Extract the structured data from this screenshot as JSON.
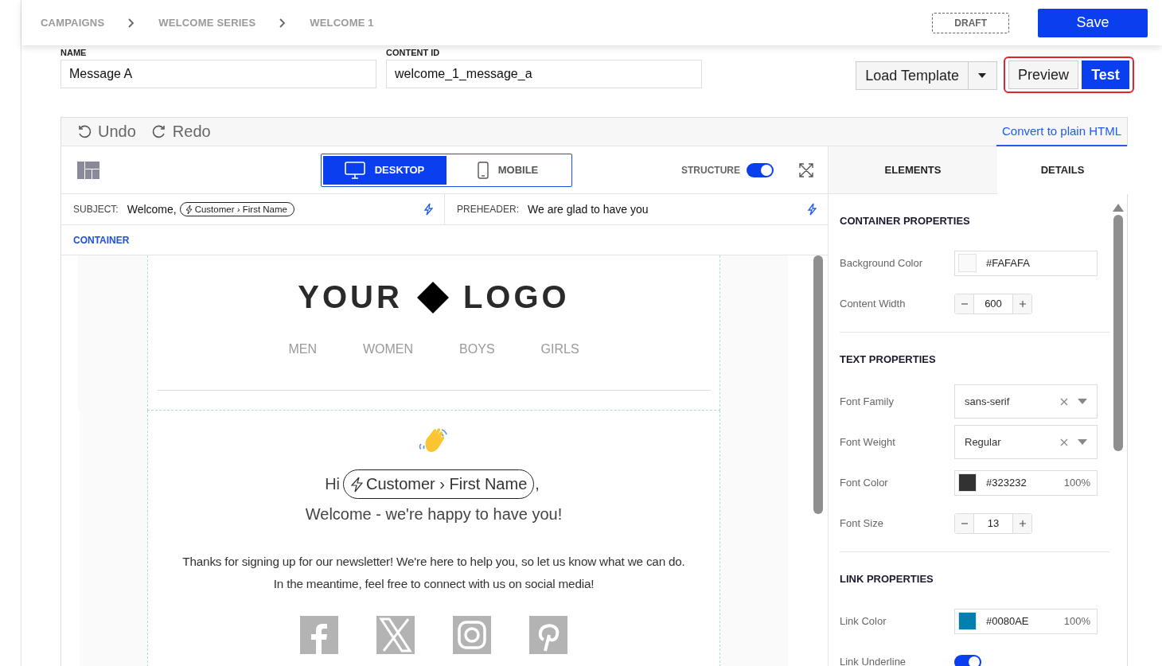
{
  "breadcrumbs": [
    "CAMPAIGNS",
    "WELCOME SERIES",
    "WELCOME 1"
  ],
  "status": "DRAFT",
  "save": "Save",
  "fields": [
    {
      "label": "NAME",
      "value": "Message A"
    },
    {
      "label": "CONTENT ID",
      "value": "welcome_1_message_a"
    }
  ],
  "actions": {
    "load_template": "Load Template",
    "preview": "Preview",
    "test": "Test"
  },
  "editor": {
    "undo": "Undo",
    "redo": "Redo",
    "convert": "Convert to plain HTML",
    "view_modes": [
      {
        "label": "DESKTOP",
        "kind": "desktop",
        "selected": true
      },
      {
        "label": "MOBILE",
        "kind": "mobile",
        "selected": false
      }
    ],
    "structure": {
      "label": "STRUCTURE",
      "on": true
    },
    "subject": {
      "label": "SUBJECT:",
      "text": "Welcome,",
      "tag": "Customer › First Name"
    },
    "preheader": {
      "label": "PREHEADER:",
      "text": "We are glad to have you"
    },
    "selection": "CONTAINER"
  },
  "email": {
    "logo": [
      "YOUR",
      "LOGO"
    ],
    "nav": [
      "MEN",
      "WOMEN",
      "BOYS",
      "GIRLS"
    ],
    "greeting": "Hi",
    "tag": "Customer › First Name",
    "comma": ",",
    "welcome": "Welcome - we're happy to have you!",
    "body": [
      "Thanks for signing up for our newsletter! We're here to help you, so let us know what we can do.",
      "In the meantime, feel free to connect with us on social media!"
    ],
    "social": [
      {
        "kind": "facebook"
      },
      {
        "kind": "x"
      },
      {
        "kind": "instagram"
      },
      {
        "kind": "pinterest"
      }
    ]
  },
  "panel": {
    "tabs": [
      {
        "label": "ELEMENTS",
        "selected": false
      },
      {
        "label": "DETAILS",
        "selected": true
      }
    ],
    "sections": [
      {
        "title": "CONTAINER PROPERTIES",
        "rows": [
          {
            "kind": "color",
            "label": "Background Color",
            "value": "#FAFAFA",
            "color": "#fafafa"
          },
          {
            "kind": "stepper",
            "label": "Content Width",
            "value": "600"
          }
        ]
      },
      {
        "title": "TEXT PROPERTIES",
        "rows": [
          {
            "kind": "select",
            "label": "Font Family",
            "value": "sans-serif"
          },
          {
            "kind": "select",
            "label": "Font Weight",
            "value": "Regular"
          },
          {
            "kind": "color",
            "label": "Font Color",
            "value": "#323232",
            "color": "#323232",
            "opacity": "100%"
          },
          {
            "kind": "stepper",
            "label": "Font Size",
            "value": "13"
          }
        ]
      },
      {
        "title": "LINK PROPERTIES",
        "rows": [
          {
            "kind": "color",
            "label": "Link Color",
            "value": "#0080AE",
            "color": "#0080ae",
            "opacity": "100%"
          },
          {
            "kind": "toggle",
            "label": "Link Underline",
            "on": true
          }
        ]
      }
    ]
  }
}
